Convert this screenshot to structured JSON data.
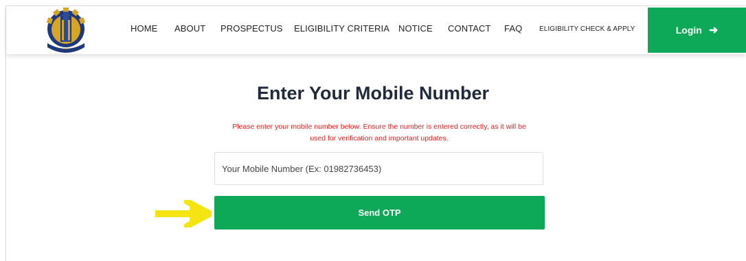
{
  "navbar": {
    "logo_icon": "university-crest-logo",
    "links": [
      {
        "label": "HOME"
      },
      {
        "label": "ABOUT"
      },
      {
        "label": "PROSPECTUS"
      },
      {
        "label": "ELIGIBILITY CRITERIA"
      },
      {
        "label": "NOTICE"
      },
      {
        "label": "CONTACT"
      },
      {
        "label": "FAQ"
      },
      {
        "label": "ELIGIBILITY CHECK & APPLY"
      }
    ],
    "login": {
      "label": "Login",
      "icon": "arrow-right-icon",
      "arrow_glyph": "➜"
    }
  },
  "main": {
    "title": "Enter Your Mobile Number",
    "instruction_line1": "Please enter your mobile number below. Ensure the number is entered correctly, as it will be",
    "instruction_line2": "used for verification and important updates.",
    "mobile_input": {
      "placeholder": "Your Mobile Number (Ex: 01982736453)",
      "value": ""
    },
    "send_otp_label": "Send OTP",
    "annotation_icon": "yellow-arrow-icon"
  },
  "colors": {
    "accent_green": "#0ea958",
    "warning_red": "#e0201f",
    "title_dark": "#1f2b3a",
    "annotation_yellow": "#f5e312"
  }
}
